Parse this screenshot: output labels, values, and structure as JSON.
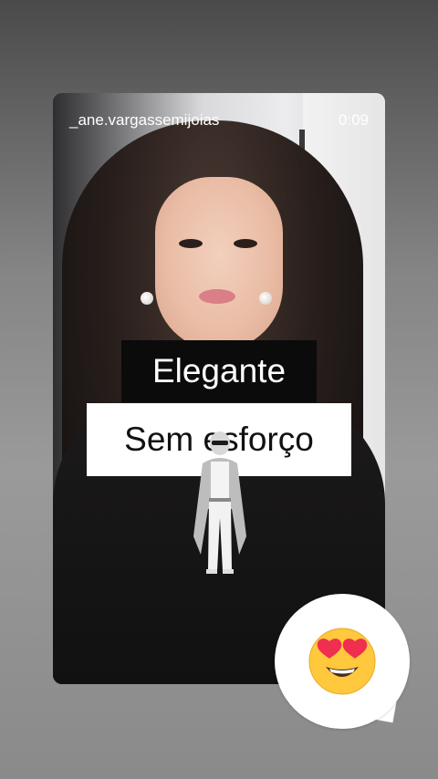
{
  "story": {
    "username": "_ane.vargassemijoias",
    "timestamp": "0:09"
  },
  "captions": {
    "line1": "Elegante",
    "line2": "Sem esforço"
  },
  "reaction": {
    "emoji": "😍",
    "icon": "heart-eyes-emoji-icon"
  },
  "colors": {
    "caption1_bg": "#0b0b0b",
    "caption2_bg": "#ffffff"
  }
}
